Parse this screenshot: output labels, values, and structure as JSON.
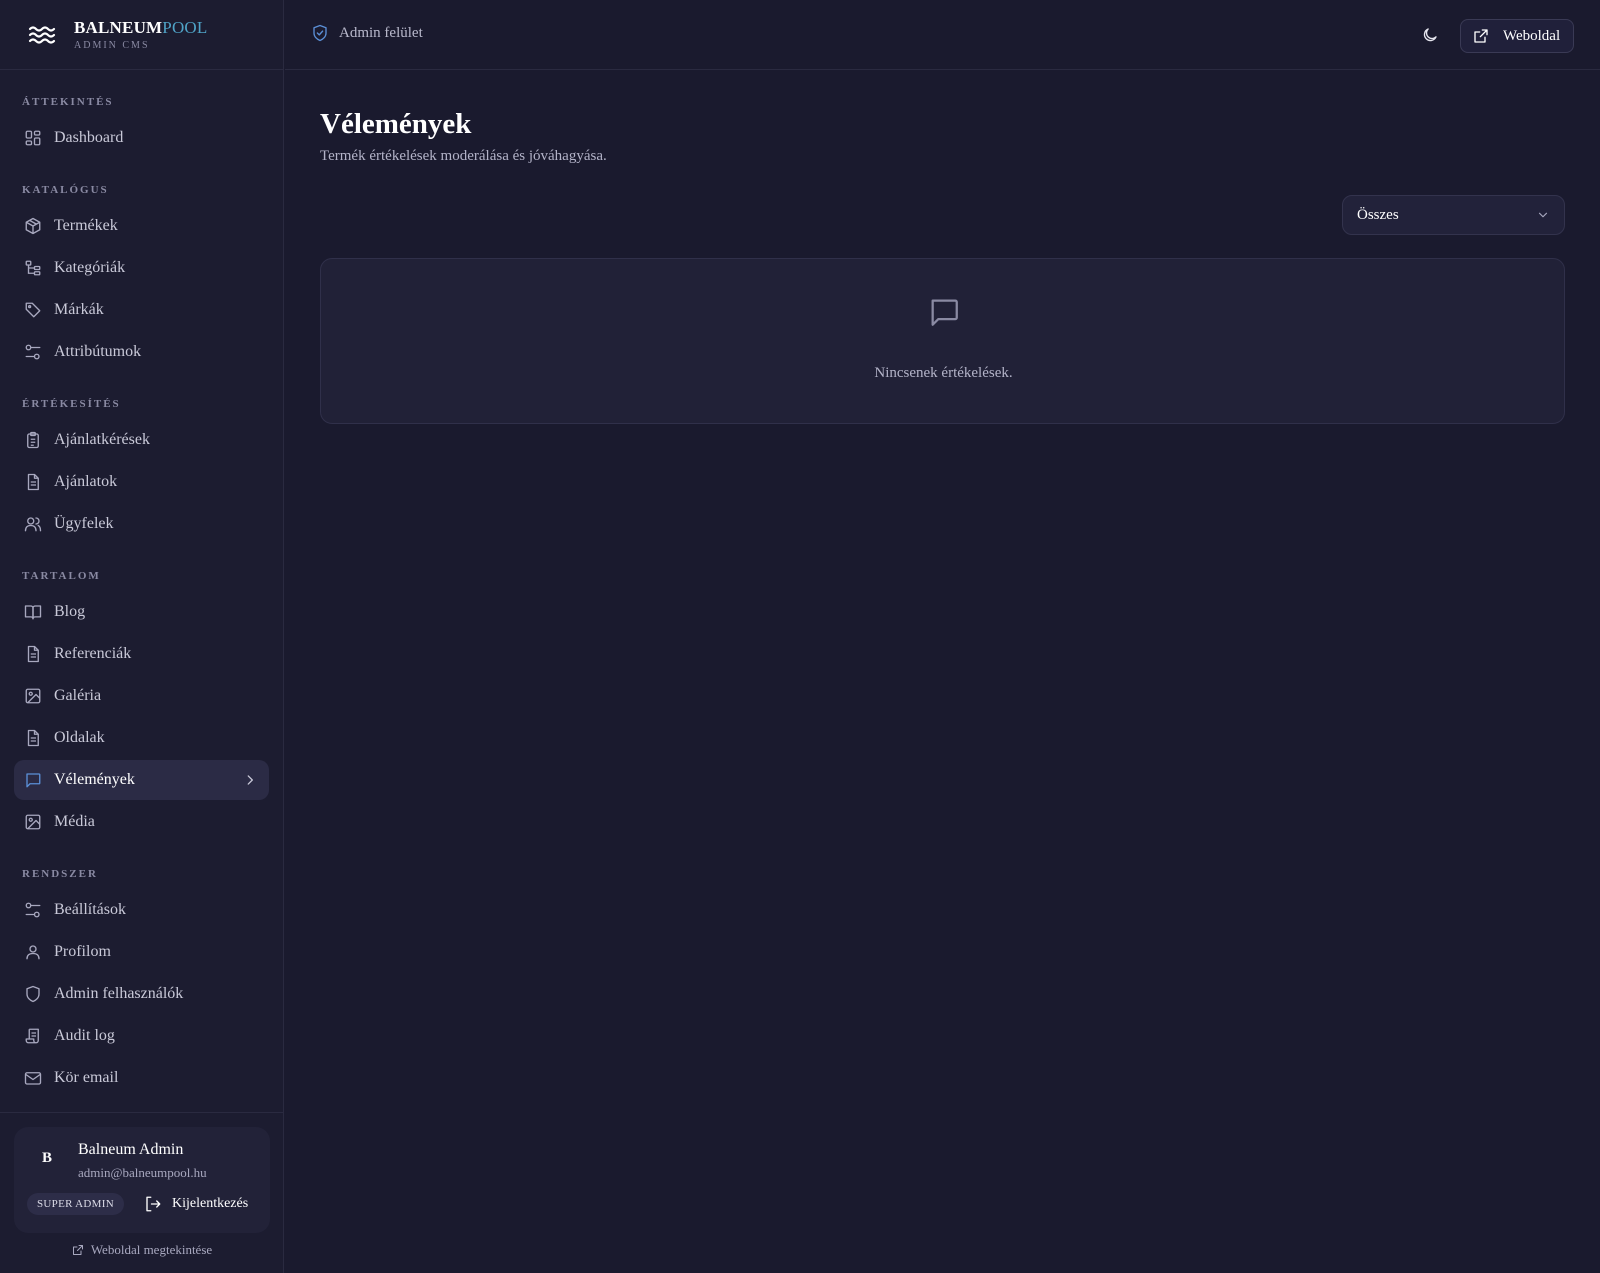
{
  "brand": {
    "name_primary": "BALNEUM",
    "name_accent": "POOL",
    "subtitle": "ADMIN CMS"
  },
  "topbar": {
    "title": "Admin felület",
    "website_button": "Weboldal"
  },
  "sidebar": {
    "sections": [
      {
        "title": "ÁTTEKINTÉS",
        "items": [
          {
            "label": "Dashboard",
            "icon": "dashboard-icon"
          }
        ]
      },
      {
        "title": "KATALÓGUS",
        "items": [
          {
            "label": "Termékek",
            "icon": "box-icon"
          },
          {
            "label": "Kategóriák",
            "icon": "tree-icon"
          },
          {
            "label": "Márkák",
            "icon": "tag-icon"
          },
          {
            "label": "Attribútumok",
            "icon": "sliders-icon"
          }
        ]
      },
      {
        "title": "ÉRTÉKESÍTÉS",
        "items": [
          {
            "label": "Ajánlatkérések",
            "icon": "clipboard-icon"
          },
          {
            "label": "Ajánlatok",
            "icon": "document-icon"
          },
          {
            "label": "Ügyfelek",
            "icon": "users-icon"
          }
        ]
      },
      {
        "title": "TARTALOM",
        "items": [
          {
            "label": "Blog",
            "icon": "book-icon"
          },
          {
            "label": "Referenciák",
            "icon": "document-icon"
          },
          {
            "label": "Galéria",
            "icon": "image-icon"
          },
          {
            "label": "Oldalak",
            "icon": "document-icon"
          },
          {
            "label": "Vélemények",
            "icon": "message-icon",
            "active": true
          },
          {
            "label": "Média",
            "icon": "image-icon"
          }
        ]
      },
      {
        "title": "RENDSZER",
        "items": [
          {
            "label": "Beállítások",
            "icon": "sliders-icon"
          },
          {
            "label": "Profilom",
            "icon": "user-icon"
          },
          {
            "label": "Admin felhasználók",
            "icon": "shield-icon"
          },
          {
            "label": "Audit log",
            "icon": "scroll-icon"
          },
          {
            "label": "Kör email",
            "icon": "mail-icon"
          }
        ]
      }
    ]
  },
  "user": {
    "initial": "B",
    "name": "Balneum Admin",
    "email": "admin@balneumpool.hu",
    "role": "SUPER ADMIN",
    "logout_label": "Kijelentkezés",
    "view_site_label": "Weboldal megtekintése"
  },
  "page": {
    "title": "Vélemények",
    "subtitle": "Termék értékelések moderálása és jóváhagyása.",
    "filter_value": "Összes",
    "empty_message": "Nincsenek értékelések."
  },
  "colors": {
    "background": "#1a1a2e",
    "sidebar": "#1c1c30",
    "accent": "#4fa3c7",
    "active_item": "#2b2b45"
  }
}
